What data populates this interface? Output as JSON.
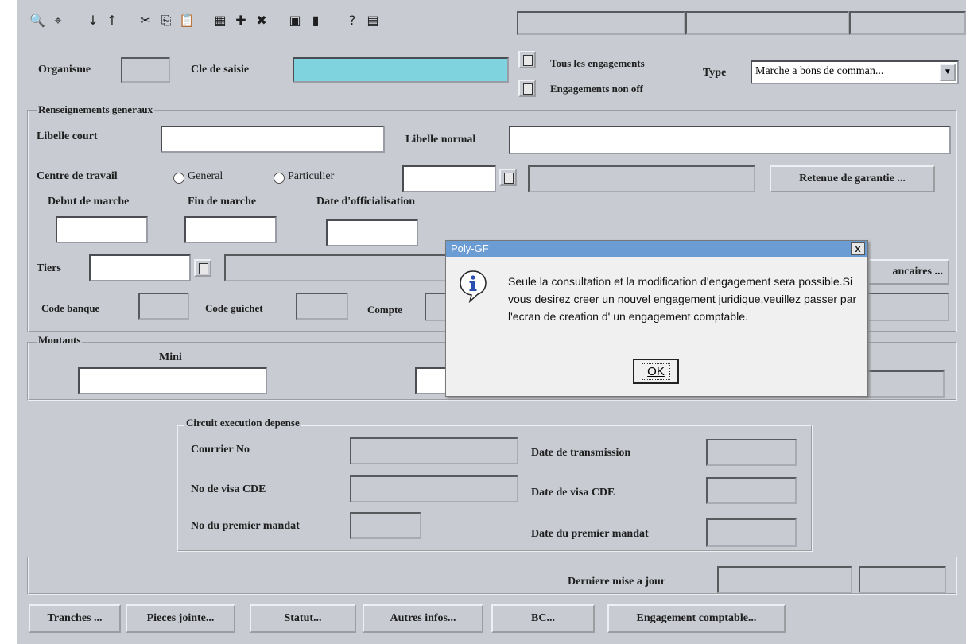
{
  "toolbar": {
    "icons": [
      "search-icon",
      "binoculars-icon",
      "arrow-down-icon",
      "arrow-up-icon",
      "cut-icon",
      "copy-icon",
      "paste-icon",
      "database-icon",
      "add-record-icon",
      "delete-record-icon",
      "save-icon",
      "close-book-icon",
      "help-icon",
      "print-icon"
    ],
    "glyphs": [
      "🔍",
      "⌖",
      "↓",
      "↑",
      "✂",
      "⎘",
      "📋",
      "▦",
      "✚",
      "✖",
      "▣",
      "▮",
      "?",
      "▤"
    ]
  },
  "header": {
    "organisme_label": "Organisme",
    "cle_label": "Cle de saisie",
    "tous_label": "Tous les engagements",
    "non_off_label": "Engagements non off",
    "type_label": "Type",
    "type_value": "Marche a bons de comman..."
  },
  "general": {
    "group_title": "Renseignements generaux",
    "libelle_court_label": "Libelle court",
    "libelle_normal_label": "Libelle normal",
    "centre_label": "Centre de travail",
    "radio_general": "General",
    "radio_particulier": "Particulier",
    "retenue_button": "Retenue de garantie ...",
    "debut_label": "Debut de marche",
    "fin_label": "Fin de marche",
    "date_off_label": "Date d'officialisation",
    "tiers_label": "Tiers",
    "bancaires_button": "ancaires ...",
    "code_banque_label": "Code banque",
    "code_guichet_label": "Code guichet",
    "compte_label": "Compte"
  },
  "montants": {
    "group_title": "Montants",
    "mini_label": "Mini"
  },
  "circuit": {
    "group_title": "Circuit execution depense",
    "courrier_label": "Courrier No",
    "transmission_label": "Date de transmission",
    "visa_no_label": "No de visa CDE",
    "visa_date_label": "Date de visa CDE",
    "mandat_no_label": "No du premier mandat",
    "mandat_date_label": "Date du premier mandat"
  },
  "footer": {
    "derniere_label": "Derniere mise a jour"
  },
  "bottom_buttons": {
    "tranches": "Tranches ...",
    "pieces": "Pieces jointe...",
    "statut": "Statut...",
    "autres": "Autres infos...",
    "bc": "BC...",
    "engagement": "Engagement comptable..."
  },
  "dialog": {
    "title": "Poly-GF",
    "close": "x",
    "message": "Seule la consultation et la modification d'engagement sera possible.Si vous desirez creer un nouvel engagement juridique,veuillez passer par l'ecran de creation d' un engagement comptable.",
    "ok": "OK"
  },
  "colors": {
    "background": "#c8cbd2",
    "key_field": "#7fd3df",
    "dialog_title": "#6b9dd4"
  }
}
